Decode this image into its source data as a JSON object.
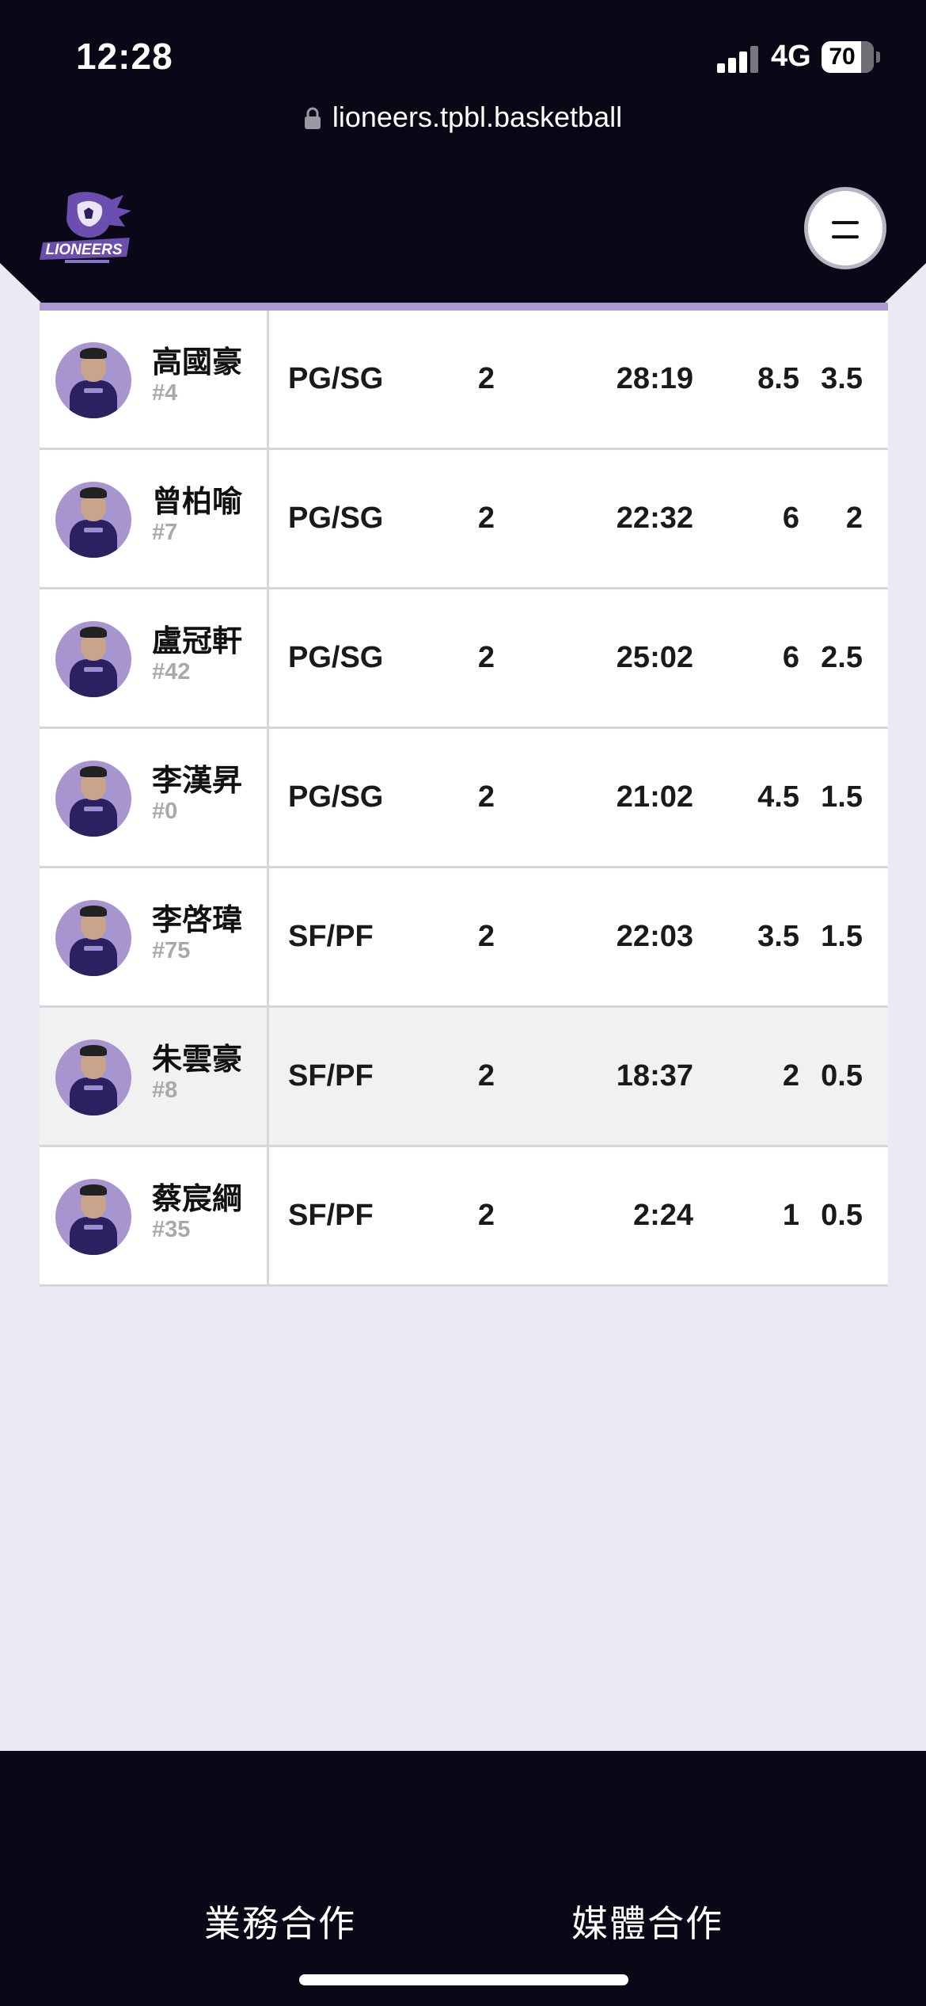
{
  "status_bar": {
    "time": "12:28",
    "network": "4G",
    "battery": "70"
  },
  "browser": {
    "url": "lioneers.tpbl.basketball"
  },
  "header": {
    "logo_icon": "lioneers-logo",
    "logo_text": "LIONEERS",
    "menu_icon": "menu-icon"
  },
  "table": {
    "rows": [
      {
        "name": "高國豪",
        "number": "#4",
        "position": "PG/SG",
        "gp": "2",
        "min": "28:19",
        "pts": "8.5",
        "reb": "3.5",
        "highlighted": false
      },
      {
        "name": "曾柏喻",
        "number": "#7",
        "position": "PG/SG",
        "gp": "2",
        "min": "22:32",
        "pts": "6",
        "reb": "2",
        "highlighted": false
      },
      {
        "name": "盧冠軒",
        "number": "#42",
        "position": "PG/SG",
        "gp": "2",
        "min": "25:02",
        "pts": "6",
        "reb": "2.5",
        "highlighted": false
      },
      {
        "name": "李漢昇",
        "number": "#0",
        "position": "PG/SG",
        "gp": "2",
        "min": "21:02",
        "pts": "4.5",
        "reb": "1.5",
        "highlighted": false
      },
      {
        "name": "李啓瑋",
        "number": "#75",
        "position": "SF/PF",
        "gp": "2",
        "min": "22:03",
        "pts": "3.5",
        "reb": "1.5",
        "highlighted": false
      },
      {
        "name": "朱雲豪",
        "number": "#8",
        "position": "SF/PF",
        "gp": "2",
        "min": "18:37",
        "pts": "2",
        "reb": "0.5",
        "highlighted": true
      },
      {
        "name": "蔡宸綱",
        "number": "#35",
        "position": "SF/PF",
        "gp": "2",
        "min": "2:24",
        "pts": "1",
        "reb": "0.5",
        "highlighted": false
      }
    ]
  },
  "footer": {
    "business_label": "業務合作",
    "media_label": "媒體合作"
  },
  "colors": {
    "header_bg": "#0A0816",
    "page_bg": "#ECE9F4",
    "accent_purple": "#A99BD0",
    "highlight_row": "#F1F1F1"
  }
}
